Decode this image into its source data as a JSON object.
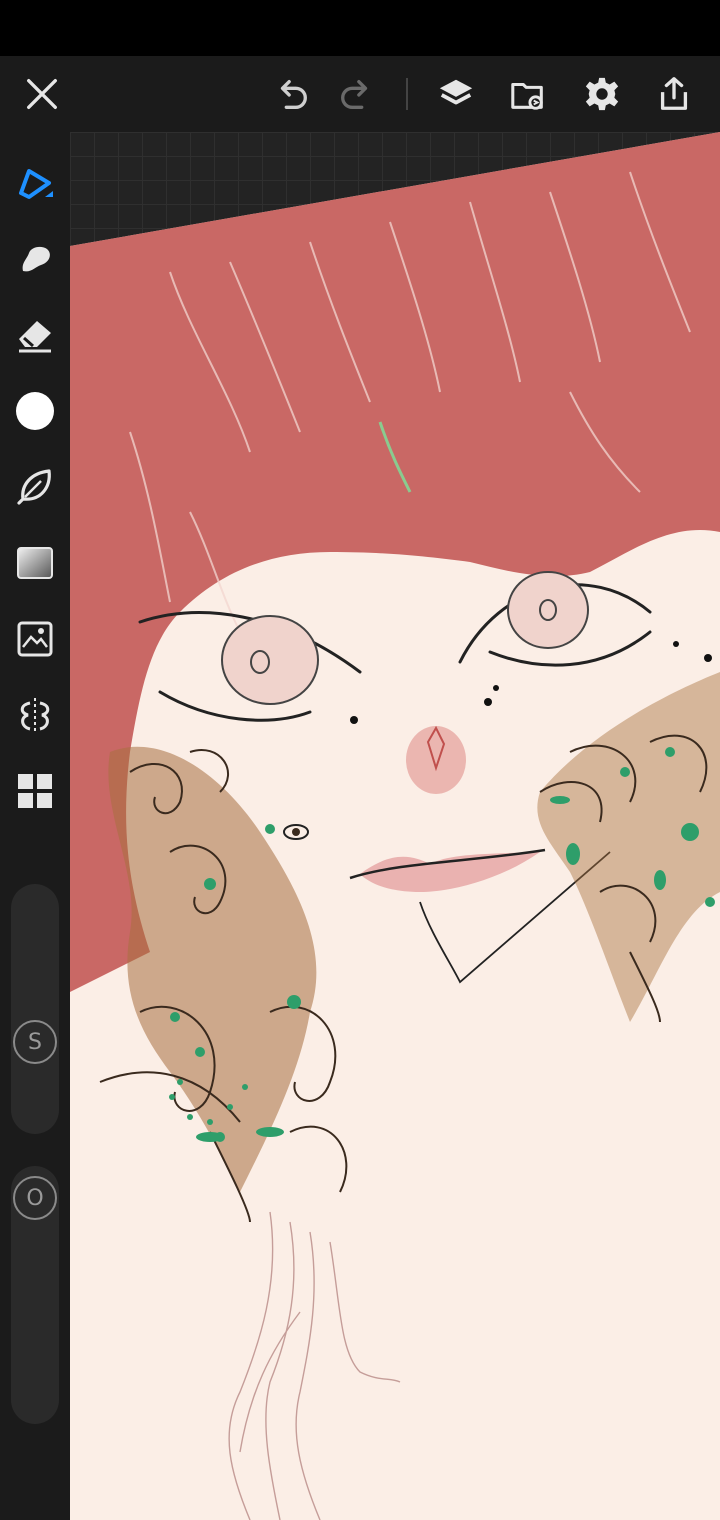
{
  "app": {
    "accent": "#1e90ff",
    "bg": "#1b1b1b"
  },
  "toolbar": {
    "icons": [
      "close-icon",
      "undo-icon",
      "redo-icon",
      "layers-icon",
      "gallery-import-icon",
      "settings-icon",
      "share-icon"
    ]
  },
  "tools": {
    "items": [
      "brush-tool-icon",
      "smudge-tool-icon",
      "eraser-tool-icon",
      "color-swatch",
      "lasso-tool-icon",
      "fill-gradient-icon",
      "image-adjust-icon",
      "symmetry-icon",
      "quick-menu-icon"
    ],
    "active": "brush-tool-icon",
    "current_color": "#ffffff"
  },
  "sliders": {
    "size_label": "S",
    "opacity_label": "O"
  },
  "canvas": {
    "paper_color": "#fbeee6",
    "hair_color": "#c0504d",
    "ornament_color": "#a8703f",
    "gem_color": "#2e9e6a"
  }
}
